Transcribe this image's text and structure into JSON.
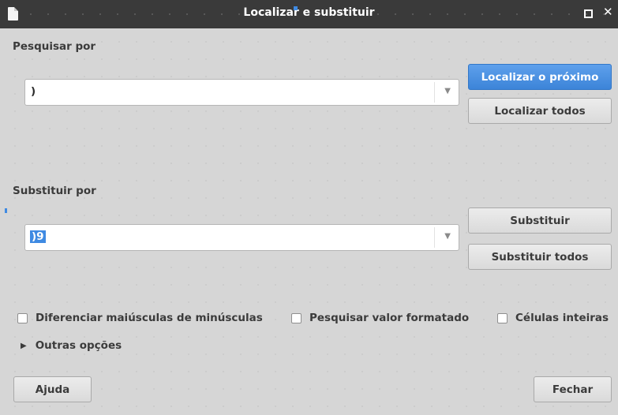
{
  "window": {
    "title": "Localizar e substituir",
    "icons": [
      "app-icon",
      "maximize-icon",
      "close-icon"
    ],
    "close_glyph": "✕"
  },
  "search": {
    "label": "Pesquisar por",
    "value": ")"
  },
  "replace": {
    "label": "Substituir por",
    "value": ")9"
  },
  "buttons": {
    "find_next": "Localizar o próximo",
    "find_all": "Localizar todos",
    "replace": "Substituir",
    "replace_all": "Substituir todos",
    "help": "Ajuda",
    "close": "Fechar"
  },
  "options": {
    "match_case": {
      "label": "Diferenciar maiúsculas de minúsculas",
      "checked": false
    },
    "formatted": {
      "label": "Pesquisar valor formatado",
      "checked": false
    },
    "entire_cells": {
      "label": "Células inteiras",
      "checked": false
    },
    "other_options": "Outras opções"
  },
  "colors": {
    "accent": "#3f8ae2",
    "titlebar": "#3a3a3a",
    "dialog_bg": "#d6d6d6"
  }
}
